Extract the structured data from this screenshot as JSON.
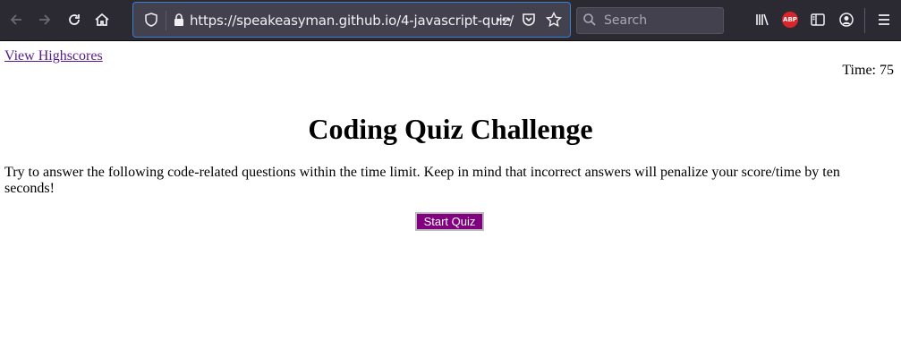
{
  "browser": {
    "url": "https://speakeasyman.github.io/4-javascript-quiz/",
    "search_placeholder": "Search",
    "icons": [
      "back-icon",
      "forward-icon",
      "reload-icon",
      "home-icon",
      "shield-icon",
      "lock-icon",
      "more-icon",
      "pocket-icon",
      "bookmark-star-icon",
      "search-icon",
      "library-icon",
      "adblock-icon",
      "sidebar-icon",
      "account-icon",
      "menu-icon"
    ],
    "adblock_badge": "ABP"
  },
  "page": {
    "highscores_link": "View Highscores",
    "timer_label": "Time:",
    "timer_value": "75",
    "title": "Coding Quiz Challenge",
    "instructions": "Try to answer the following code-related questions within the time limit. Keep in mind that incorrect answers will penalize your score/time by ten seconds!",
    "start_button": "Start Quiz"
  },
  "colors": {
    "start_button_bg": "#800080",
    "link": "#551a8b",
    "toolbar_bg": "#2b2a33"
  }
}
